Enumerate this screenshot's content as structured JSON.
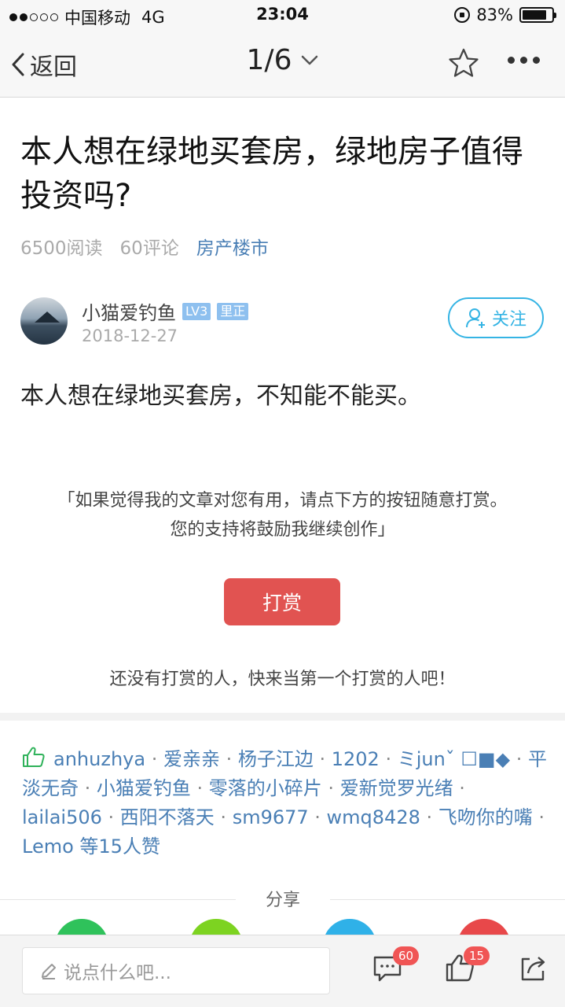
{
  "status_bar": {
    "carrier": "中国移动",
    "network": "4G",
    "time": "23:04",
    "battery_percent_label": "83%",
    "battery_level": 0.83,
    "signal_bars_filled": 2,
    "signal_bars_total": 5
  },
  "navbar": {
    "back_label": "返回",
    "page_indicator": "1/6"
  },
  "article": {
    "title": "本人想在绿地买套房，绿地房子值得投资吗?",
    "reads": "6500阅读",
    "comments": "60评论",
    "category": "房产楼市",
    "author": {
      "name": "小猫爱钓鱼",
      "level_badge": "LV3",
      "title_badge": "里正",
      "date": "2018-12-27"
    },
    "follow_label": "关注",
    "body": "本人想在绿地买套房，不知能不能买。"
  },
  "reward": {
    "prompt_line1": "「如果觉得我的文章对您有用，请点下方的按钮随意打赏。",
    "prompt_line2": "您的支持将鼓励我继续创作」",
    "button_label": "打赏",
    "empty_text": "还没有打赏的人，快来当第一个打赏的人吧！"
  },
  "likes": {
    "names": [
      "anhuzhya",
      "爱亲亲",
      "杨子江边",
      "1202",
      "ミjunˇ ☐■◆",
      "平淡无奇",
      "小猫爱钓鱼",
      "零落的小碎片",
      "爱新觉罗光绪",
      "lailai506",
      "西阳不落天",
      "sm9677",
      "wmq8428",
      "飞吻你的嘴",
      "Lemo"
    ],
    "suffix": "等15人赞"
  },
  "share": {
    "label": "分享",
    "colors": [
      "#2fc25b",
      "#7dd321",
      "#2fb1e8",
      "#e8484a"
    ]
  },
  "bottom_bar": {
    "comment_placeholder": "说点什么吧...",
    "comment_count": "60",
    "like_count": "15"
  },
  "colors": {
    "accent_blue": "#35b4e4",
    "link_blue": "#4a7fb5",
    "reward_red": "#e15351",
    "badge_red": "#f05555"
  }
}
